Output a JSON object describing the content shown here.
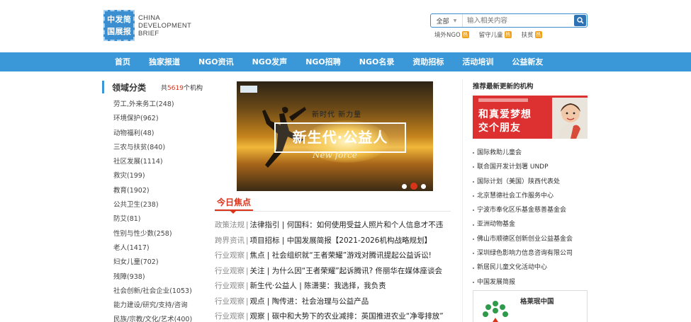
{
  "header": {
    "logo_chars": [
      "中",
      "发",
      "简",
      "国",
      "展",
      "报"
    ],
    "logo_text": [
      "CHINA",
      "DEVELOPMENT",
      "BRIEF"
    ],
    "search": {
      "scope": "全部",
      "placeholder": "输入相关内容"
    },
    "hot_tags": [
      {
        "label": "境外NGO",
        "badge": "热"
      },
      {
        "label": "留守儿童",
        "badge": "热"
      },
      {
        "label": "扶贫",
        "badge": "热"
      }
    ]
  },
  "nav": {
    "items": [
      "首页",
      "独家报道",
      "NGO资讯",
      "NGO发声",
      "NGO招聘",
      "NGO名录",
      "资助招标",
      "活动培训",
      "公益新友"
    ]
  },
  "left": {
    "title": "领域分类",
    "count_prefix": "共",
    "count_value": "5619",
    "count_suffix": "个机构",
    "categories": [
      "劳工,外来务工(248)",
      "环境保护(962)",
      "动物福利(48)",
      "三农与扶贫(840)",
      "社区发展(1114)",
      "救灾(199)",
      "教育(1902)",
      "公共卫生(238)",
      "防艾(81)",
      "性别与性少数(258)",
      "老人(1417)",
      "妇女儿童(702)",
      "残障(938)",
      "社会创新/社会企业(1053)",
      "能力建设/研究/支持/咨询",
      "民族/宗教/文化/艺术(400)"
    ]
  },
  "banner": {
    "small_text": "新时代  新力量",
    "main_text": "新生代·公益人",
    "sub_text": "New  force"
  },
  "focus": {
    "title": "今日焦点",
    "news": [
      {
        "cat": "政策法规",
        "text": "法律指引 | 何国科：如何使用受益人照片和个人信息才不违"
      },
      {
        "cat": "跨界资讯",
        "text": "项目招标 | 中国发展简报【2021-2026机构战略规划】"
      },
      {
        "cat": "行业观察",
        "text": "焦点 | 社会组织就“王者荣耀”游戏对腾讯提起公益诉讼!"
      },
      {
        "cat": "行业观察",
        "text": "关注 | 为什么因“王者荣耀”起诉腾讯? 佟丽华在媒体座谈会"
      },
      {
        "cat": "行业观察",
        "text": "新生代·公益人 | 陈潇斐：我选择，我负责"
      },
      {
        "cat": "行业观察",
        "text": "观点 | 陶传进：社会治理与公益产品"
      },
      {
        "cat": "行业观察",
        "text": "观察 | 碳中和大势下的农业减排：英国推进农业“净零排放”"
      }
    ]
  },
  "right": {
    "title": "推荐最新更新的机构",
    "ad_line1": "和真爱梦想",
    "ad_line2": "交个朋友",
    "orgs": [
      "国际救助儿童会",
      "联合国开发计划署 UNDP",
      "国际计划（美国）陕西代表处",
      "北京慧德社会工作服务中心",
      "宁波市奉化区乐基金慈善基金会",
      "亚洲动物基金",
      "佛山市顺德区创新创业公益基金会",
      "深圳绿色影响力信息咨询有限公司",
      "新居民儿童文化活动中心",
      "中国发展简报"
    ],
    "card_title": "格莱珉中国"
  },
  "colors": {
    "brand_blue": "#3b98d8",
    "accent_red": "#d9331a",
    "badge_orange": "#f0a31a"
  }
}
